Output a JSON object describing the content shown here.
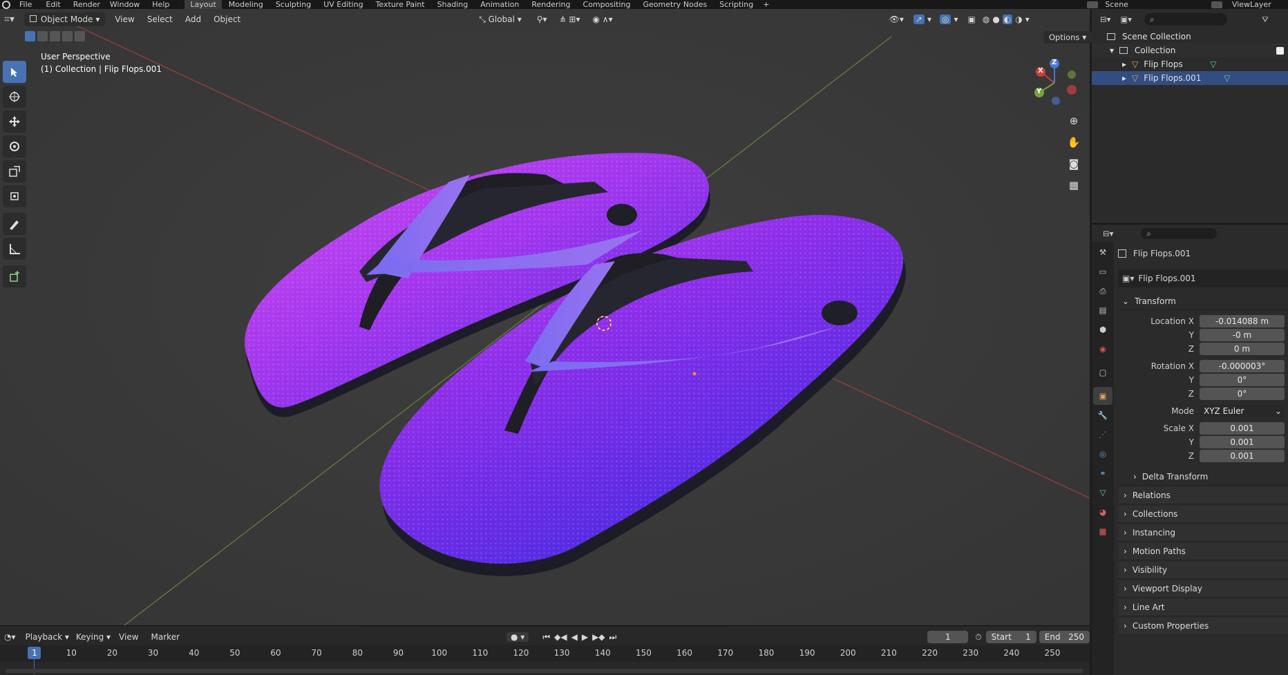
{
  "menu": {
    "items": [
      "File",
      "Edit",
      "Render",
      "Window",
      "Help"
    ],
    "workspaces": [
      "Layout",
      "Modeling",
      "Sculpting",
      "UV Editing",
      "Texture Paint",
      "Shading",
      "Animation",
      "Rendering",
      "Compositing",
      "Geometry Nodes",
      "Scripting"
    ],
    "active_workspace": "Layout",
    "add_tab": "+",
    "scene": "Scene",
    "view_layer": "ViewLayer"
  },
  "viewport": {
    "mode": "Object Mode",
    "menus": [
      "View",
      "Select",
      "Add",
      "Object"
    ],
    "orientation": "Global",
    "options": "Options",
    "perspective_label": "User Perspective",
    "collection_label": "(1) Collection | Flip Flops.001",
    "gizmo": {
      "x": "X",
      "y": "Y",
      "z": "Z"
    }
  },
  "timeline": {
    "menus": [
      "Playback",
      "Keying",
      "View",
      "Marker"
    ],
    "current_frame": "1",
    "start_label": "Start",
    "start": "1",
    "end_label": "End",
    "end": "250",
    "ticks": [
      "1",
      "10",
      "20",
      "30",
      "40",
      "50",
      "60",
      "70",
      "80",
      "90",
      "100",
      "110",
      "120",
      "130",
      "140",
      "150",
      "160",
      "170",
      "180",
      "190",
      "200",
      "210",
      "220",
      "230",
      "240",
      "250"
    ]
  },
  "outliner": {
    "scene_collection": "Scene Collection",
    "collection": "Collection",
    "objects": [
      "Flip Flops",
      "Flip Flops.001"
    ]
  },
  "properties": {
    "object_name": "Flip Flops.001",
    "datablock": "Flip Flops.001",
    "transform_title": "Transform",
    "location": {
      "label": "Location X",
      "x": "-0.014088 m",
      "y": "-0 m",
      "z": "0 m"
    },
    "rotation": {
      "label": "Rotation X",
      "x": "-0.000003°",
      "y": "0°",
      "z": "0°"
    },
    "mode_label": "Mode",
    "mode": "XYZ Euler",
    "scale": {
      "label": "Scale X",
      "x": "0.001",
      "y": "0.001",
      "z": "0.001"
    },
    "axis_y": "Y",
    "axis_z": "Z",
    "delta": "Delta Transform",
    "panels": [
      "Relations",
      "Collections",
      "Instancing",
      "Motion Paths",
      "Visibility",
      "Viewport Display",
      "Line Art",
      "Custom Properties"
    ]
  },
  "colors": {
    "accent": "#4772b3",
    "x_axis": "#c8403c",
    "y_axis": "#78a03c",
    "z_axis": "#4a7ad0",
    "flipflop_pink": "#c94ff0",
    "flipflop_blue": "#5a2ee8"
  }
}
